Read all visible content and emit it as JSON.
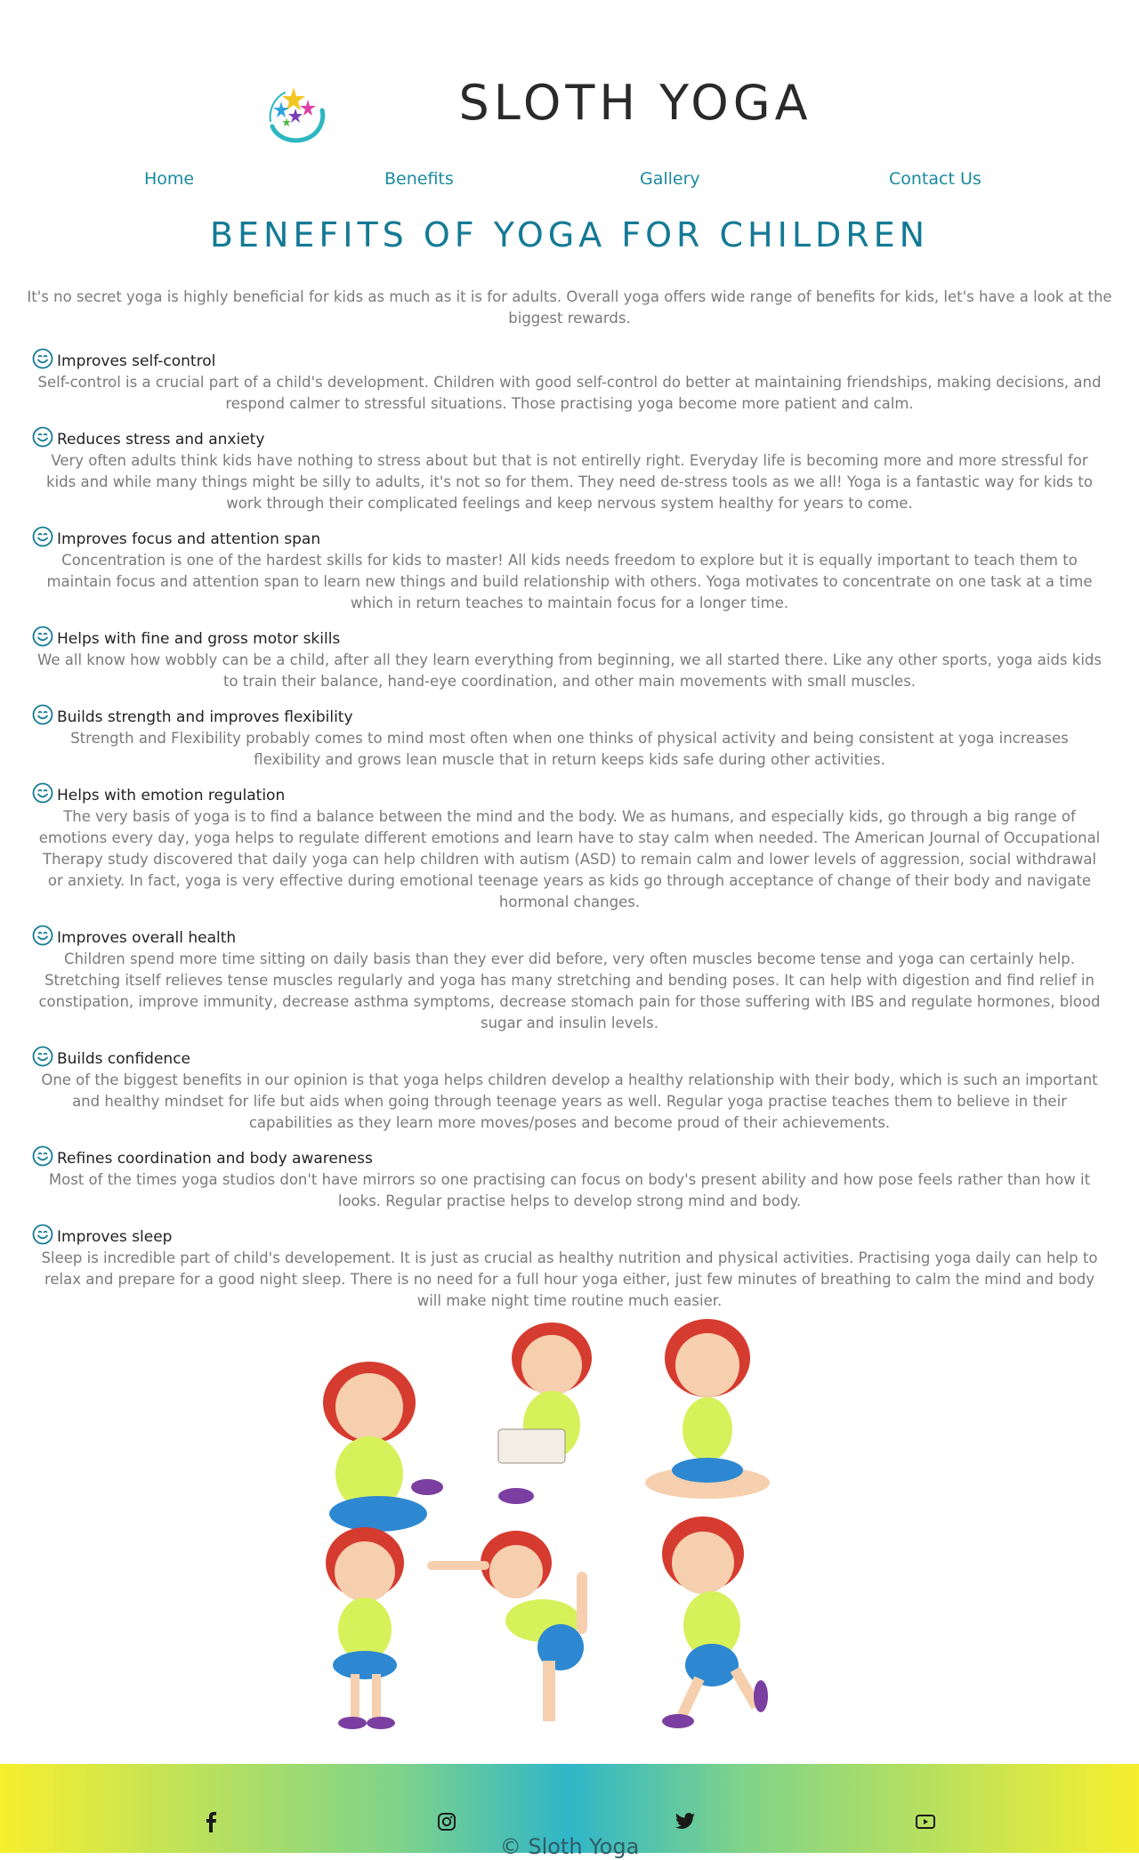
{
  "header": {
    "title": "SLOTH YOGA",
    "logo_icon": "yoga-stars-logo"
  },
  "nav": {
    "items": [
      {
        "label": "Home"
      },
      {
        "label": "Benefits"
      },
      {
        "label": "Gallery"
      },
      {
        "label": "Contact Us"
      }
    ]
  },
  "page": {
    "heading": "BENEFITS OF YOGA FOR CHILDREN",
    "intro": "It's no secret yoga is highly beneficial for kids as much as it is for adults. Overall yoga offers wide range of benefits for kids, let's have a look at the biggest rewards."
  },
  "benefits": [
    {
      "title": "Improves self-control",
      "text": "Self-control is a crucial part of a child's development. Children with good self-control do better at maintaining friendships, making decisions, and respond calmer to stressful situations. Those practising yoga become more patient and calm."
    },
    {
      "title": "Reduces stress and anxiety",
      "text": "Very often adults think kids have nothing to stress about but that is not entirelly right. Everyday life is becoming more and more stressful for kids and while many things might be silly to adults, it's not so for them. They need de-stress tools as we all! Yoga is a fantastic way for kids to work through their complicated feelings and keep nervous system healthy for years to come."
    },
    {
      "title": "Improves focus and attention span",
      "text": "Concentration is one of the hardest skills for kids to master! All kids needs freedom to explore but it is equally important to teach them to maintain focus and attention span to learn new things and build relationship with others. Yoga motivates to concentrate on one task at a time which in return teaches to maintain focus for a longer time."
    },
    {
      "title": "Helps with fine and gross motor skills",
      "text": "We all know how wobbly can be a child, after all they learn everything from beginning, we all started there. Like any other sports, yoga aids kids to train their balance, hand-eye coordination, and other main movements with small muscles."
    },
    {
      "title": "Builds strength and improves flexibility",
      "text": "Strength and Flexibility probably comes to mind most often when one thinks of physical activity and being consistent at yoga increases flexibility and grows lean muscle that in return keeps kids safe during other activities."
    },
    {
      "title": "Helps with emotion regulation",
      "text": "The very basis of yoga is to find a balance between the mind and the body. We as humans, and especially kids, go through a big range of emotions every day, yoga helps to regulate different emotions and learn have to stay calm when needed. The American Journal of Occupational Therapy study discovered that daily yoga can help children with autism (ASD) to remain calm and lower levels of aggression, social withdrawal or anxiety. In fact, yoga is very effective during emotional teenage years as kids go through acceptance of change of their body and navigate hormonal changes."
    },
    {
      "title": "Improves overall health",
      "text": "Children spend more time sitting on daily basis than they ever did before, very often muscles become tense and yoga can certainly help. Stretching itself relieves tense muscles regularly and yoga has many stretching and bending poses. It can help with digestion and find relief in constipation, improve immunity, decrease asthma symptoms, decrease stomach pain for those suffering with IBS and regulate hormones, blood sugar and insulin levels."
    },
    {
      "title": "Builds confidence",
      "text": "One of the biggest benefits in our opinion is that yoga helps children develop a healthy relationship with their body, which is such an important and healthy mindset for life but aids when going through teenage years as well. Regular yoga practise teaches them to believe in their capabilities as they learn more moves/poses and become proud of their achievements."
    },
    {
      "title": "Refines coordination and body awareness",
      "text": "Most of the times yoga studios don't have mirrors so one practising can focus on body's present ability and how pose feels rather than how it looks. Regular practise helps to develop strong mind and body."
    },
    {
      "title": "Improves sleep",
      "text": "Sleep is incredible part of child's developement. It is just as crucial as healthy nutrition and physical activities. Practising yoga daily can help to relax and prepare for a good night sleep. There is no need for a full hour yoga either, just few minutes of breathing to calm the mind and body will make night time routine much easier."
    }
  ],
  "illustration": {
    "icon": "girl-yoga-poses-illustration"
  },
  "footer": {
    "icons": [
      "facebook-icon",
      "instagram-icon",
      "twitter-icon",
      "youtube-icon"
    ],
    "copyright": "© Sloth Yoga"
  },
  "colors": {
    "accent": "#147a95",
    "nav": "#1a8aa0",
    "footer_yellow": "#f7ef2e",
    "footer_teal": "#2fb6c8"
  }
}
